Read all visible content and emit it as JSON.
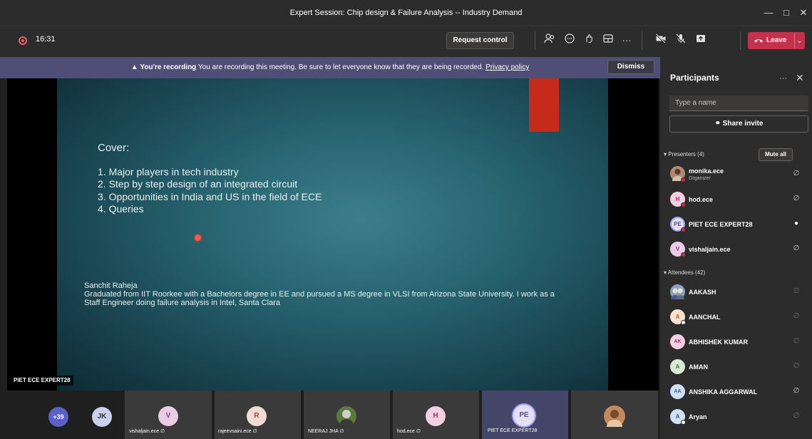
{
  "window": {
    "title": "Expert Session: Chip design & Failure Analysis -- Industry Demand",
    "controls": [
      "minimize-icon",
      "maximize-icon",
      "close-icon"
    ]
  },
  "toolbar": {
    "timer": "16:31",
    "request_control": "Request control",
    "leave": "Leave",
    "icons": [
      "participants-icon",
      "chat-icon",
      "reactions-icon",
      "rooms-icon",
      "more-icon",
      "camera-off-icon",
      "mic-off-icon",
      "share-icon"
    ]
  },
  "banner": {
    "bold": "You're recording",
    "text": "You are recording this meeting. Be sure to let everyone know that they are being recorded.",
    "link": "Privacy policy",
    "dismiss": "Dismiss"
  },
  "slide": {
    "title": "Cover:",
    "items": [
      "1.  Major players in tech industry",
      "2.  Step by step design of an integrated circuit",
      "3.  Opportunities in India and US in the field of ECE",
      "4.  Queries"
    ],
    "bio_name": "Sanchit Raheja",
    "bio_text": "Graduated from IIT Roorkee with a Bachelors degree in EE and pursued a MS degree in VLSI from Arizona State University. I work as a Staff Engineer doing failure analysis in Intel, Santa Clara"
  },
  "presenter_label": "PIET ECE EXPERT28",
  "strip": {
    "overflow_count": "+39",
    "tiles": [
      {
        "initials": "JK",
        "name": ""
      },
      {
        "initials": "V",
        "name": "vishaljain.ece"
      },
      {
        "initials": "R",
        "name": "rajeevsaini.ece"
      },
      {
        "initials": "",
        "name": "NEERAJ JHA"
      },
      {
        "initials": "H",
        "name": "hod.ece"
      },
      {
        "initials": "PE",
        "name": "PIET ECE EXPERT28"
      },
      {
        "initials": "",
        "name": ""
      }
    ]
  },
  "panel": {
    "title": "Participants",
    "search_placeholder": "Type a name",
    "share_invite": "Share invite",
    "presenters_header": "Presenters (4)",
    "mute_all": "Mute all",
    "presenters": [
      {
        "initials": "",
        "name": "monika.ece",
        "sub": "Organizer"
      },
      {
        "initials": "H",
        "name": "hod.ece",
        "sub": ""
      },
      {
        "initials": "PE",
        "name": "PIET ECE EXPERT28",
        "sub": ""
      },
      {
        "initials": "V",
        "name": "vishaljain.ece",
        "sub": ""
      }
    ],
    "attendees_header": "Attendees (42)",
    "attendees": [
      {
        "initials": "",
        "name": "AAKASH"
      },
      {
        "initials": "A",
        "name": "AANCHAL"
      },
      {
        "initials": "AK",
        "name": "ABHISHEK KUMAR"
      },
      {
        "initials": "A",
        "name": "AMAN"
      },
      {
        "initials": "AA",
        "name": "ANSHIKA AGGARWAL"
      },
      {
        "initials": "A",
        "name": "Aryan"
      }
    ]
  }
}
